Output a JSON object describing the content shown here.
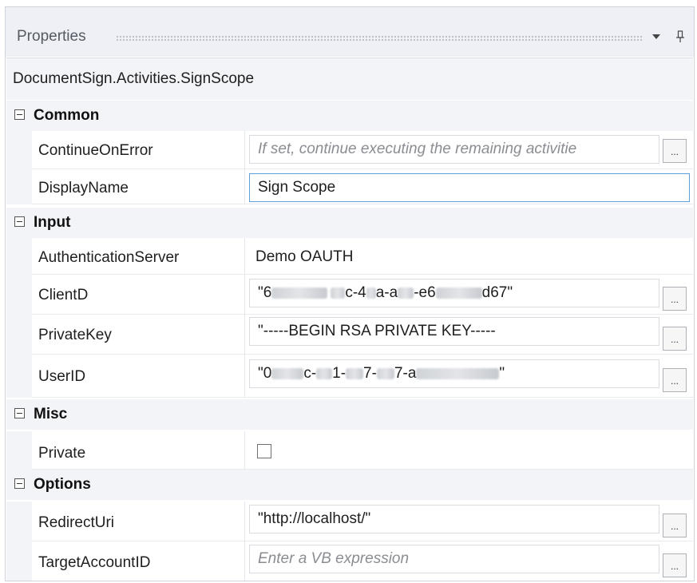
{
  "panel": {
    "title": "Properties",
    "dropdown_icon": "chevron-down-icon",
    "pin_icon": "pin-icon",
    "subtitle": "DocumentSign.Activities.SignScope"
  },
  "categories": {
    "common": "Common",
    "input": "Input",
    "misc": "Misc",
    "options": "Options"
  },
  "properties": {
    "continue_on_error": {
      "name": "ContinueOnError",
      "placeholder": "If set, continue executing the remaining activitie"
    },
    "display_name": {
      "name": "DisplayName",
      "value": "Sign Scope"
    },
    "authentication_server": {
      "name": "AuthenticationServer",
      "value": "Demo OAUTH"
    },
    "client_id": {
      "name": "ClientD",
      "v1": "\"6",
      "v2": "c-4",
      "v3": "a-a",
      "v4": "-e6",
      "v5": "d67\""
    },
    "private_key": {
      "name": "PrivateKey",
      "value": "\"-----BEGIN RSA PRIVATE KEY-----"
    },
    "user_id": {
      "name": "UserID",
      "v1": "\"0",
      "v2": "c-",
      "v3": "1-",
      "v4": "7-",
      "v5": "7-a",
      "v6": "\""
    },
    "private": {
      "name": "Private",
      "checked": false
    },
    "redirect_uri": {
      "name": "RedirectUri",
      "value": "\"http://localhost/\""
    },
    "target_account_id": {
      "name": "TargetAccountID",
      "placeholder": "Enter a VB expression"
    }
  },
  "ellipsis_label": "..."
}
